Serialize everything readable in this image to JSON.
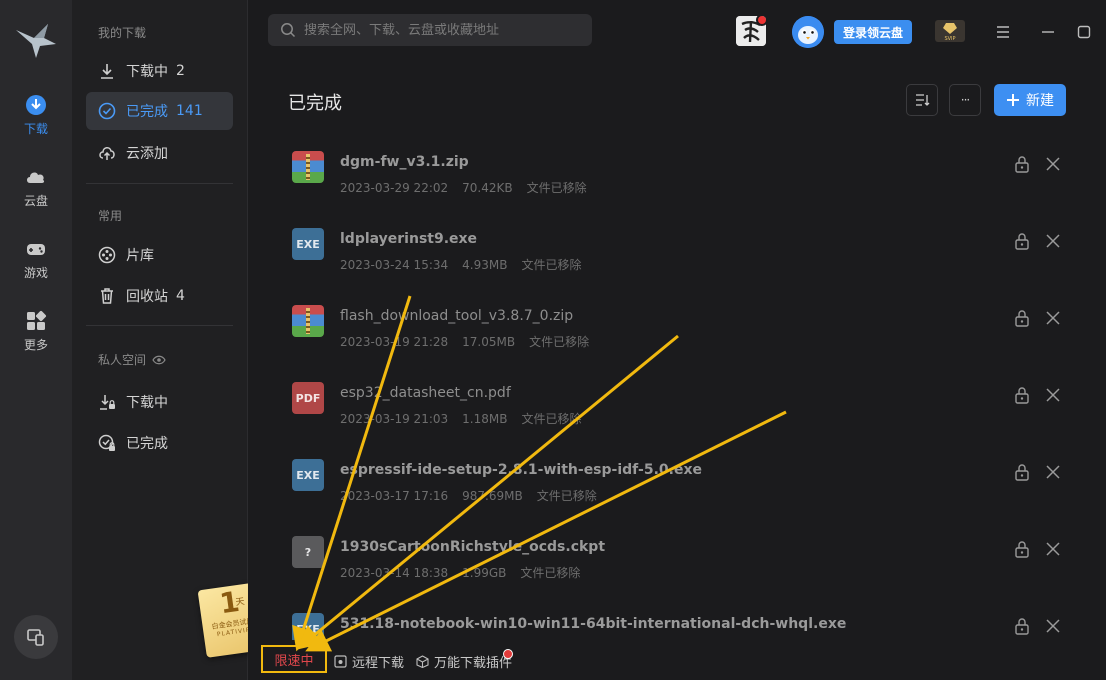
{
  "rail": {
    "items": [
      {
        "label": "下载",
        "icon": "download-circle-icon"
      },
      {
        "label": "云盘",
        "icon": "cloud-icon"
      },
      {
        "label": "游戏",
        "icon": "gamepad-icon"
      },
      {
        "label": "更多",
        "icon": "apps-grid-icon"
      }
    ],
    "active": "下载"
  },
  "nav": {
    "section_downloads": "我的下载",
    "downloading_label": "下载中",
    "downloading_count": "2",
    "completed_label": "已完成",
    "completed_count": "141",
    "cloud_add_label": "云添加",
    "section_common": "常用",
    "library_label": "片库",
    "recycle_label": "回收站",
    "recycle_count": "4",
    "section_private": "私人空间",
    "private_downloading_label": "下载中",
    "private_completed_label": "已完成"
  },
  "search": {
    "placeholder": "搜索全网、下载、云盘或收藏地址"
  },
  "header": {
    "login_label": "登录领云盘",
    "page_title": "已完成",
    "new_label": "新建",
    "more_label": "···"
  },
  "files": [
    {
      "name": "dgm-fw_v3.1.zip",
      "date": "2023-03-29 22:02",
      "size": "70.42KB",
      "status": "文件已移除",
      "type": "zip"
    },
    {
      "name": "ldplayerinst9.exe",
      "date": "2023-03-24 15:34",
      "size": "4.93MB",
      "status": "文件已移除",
      "type": "exe"
    },
    {
      "name": "flash_download_tool_v3.8.7_0.zip",
      "date": "2023-03-19 21:28",
      "size": "17.05MB",
      "status": "文件已移除",
      "type": "zip"
    },
    {
      "name": "esp32_datasheet_cn.pdf",
      "date": "2023-03-19 21:03",
      "size": "1.18MB",
      "status": "文件已移除",
      "type": "pdf"
    },
    {
      "name": "espressif-ide-setup-2.8.1-with-esp-idf-5.0.exe",
      "date": "2023-03-17 17:16",
      "size": "987.69MB",
      "status": "文件已移除",
      "type": "exe"
    },
    {
      "name": "1930sCartoonRichstyle_ocds.ckpt",
      "date": "2023-03-14 18:38",
      "size": "1.99GB",
      "status": "文件已移除",
      "type": "unknown"
    },
    {
      "name": "531.18-notebook-win10-win11-64bit-international-dch-whql.exe",
      "date": "",
      "size": "",
      "status": "",
      "type": "exe"
    }
  ],
  "file_type_labels": {
    "exe": "EXE",
    "pdf": "PDF",
    "unknown": "?"
  },
  "bottom": {
    "speed_limit": "限速中",
    "remote_download": "远程下载",
    "plugin": "万能下载插件"
  },
  "promo": {
    "number": "1",
    "unit": "天",
    "line1": "白金会员试用",
    "line2": "PLATIVIP"
  },
  "vip_badge": "SVIP",
  "colors": {
    "accent": "#3b8ef0",
    "highlight": "#f1b90f",
    "speed_limit_text": "#e0474c"
  }
}
